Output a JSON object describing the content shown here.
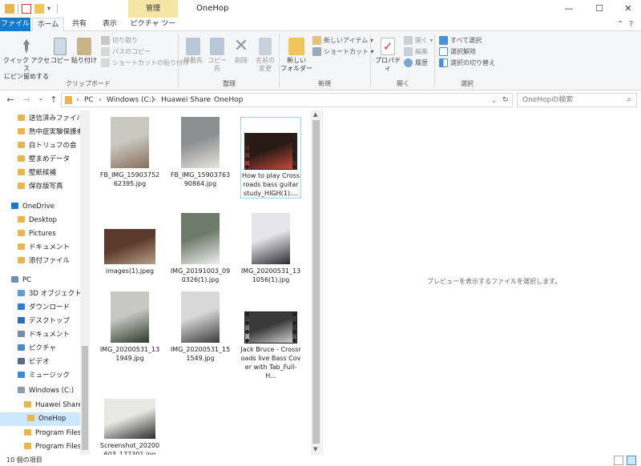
{
  "window": {
    "title": "OneHop",
    "context_tab_header": "管理",
    "controls": {
      "minimize": "—",
      "maximize": "☐",
      "close": "✕"
    }
  },
  "tabs": {
    "file": "ファイル",
    "home": "ホーム",
    "share": "共有",
    "view": "表示",
    "picture_tools": "ピクチャ ツール"
  },
  "ribbon": {
    "clipboard": {
      "pin_line1": "クイック アクセス",
      "pin_line2": "にピン留めする",
      "copy": "コピー",
      "paste": "貼り付け",
      "cut": "切り取り",
      "copy_path": "パスのコピー",
      "paste_shortcut": "ショートカットの貼り付け",
      "label": "クリップボード"
    },
    "organize": {
      "move_to": "移動先",
      "copy_to": "コピー先",
      "delete": "削除",
      "rename_line1": "名前の",
      "rename_line2": "変更",
      "label": "整理"
    },
    "new": {
      "new_folder_line1": "新しい",
      "new_folder_line2": "フォルダー",
      "new_item": "新しいアイテム",
      "shortcut": "ショートカット",
      "label": "新規"
    },
    "open": {
      "properties": "プロパティ",
      "open": "開く",
      "edit": "編集",
      "history": "履歴",
      "label": "開く"
    },
    "select": {
      "select_all": "すべて選択",
      "select_none": "選択解除",
      "invert": "選択の切り替え",
      "label": "選択"
    }
  },
  "address": {
    "crumbs": [
      "PC",
      "Windows (C:)",
      "Huawei Share",
      "OneHop"
    ],
    "search_placeholder": "OneHopの検索"
  },
  "nav": [
    {
      "label": "送信済みファイル",
      "type": "folder"
    },
    {
      "label": "熱中症実験保護者",
      "type": "folder"
    },
    {
      "label": "白トリュフの会",
      "type": "folder"
    },
    {
      "label": "壁まめデータ",
      "type": "folder"
    },
    {
      "label": "壁紙候補",
      "type": "folder"
    },
    {
      "label": "保存版写真",
      "type": "folder"
    },
    {
      "label": "OneDrive",
      "type": "cloud"
    },
    {
      "label": "Desktop",
      "type": "folder"
    },
    {
      "label": "Pictures",
      "type": "folder"
    },
    {
      "label": "ドキュメント",
      "type": "folder"
    },
    {
      "label": "添付ファイル",
      "type": "folder"
    },
    {
      "label": "PC",
      "type": "pc"
    },
    {
      "label": "3D オブジェクト",
      "type": "3d"
    },
    {
      "label": "ダウンロード",
      "type": "download"
    },
    {
      "label": "デスクトップ",
      "type": "desktop"
    },
    {
      "label": "ドキュメント",
      "type": "doc"
    },
    {
      "label": "ピクチャ",
      "type": "pic"
    },
    {
      "label": "ビデオ",
      "type": "video"
    },
    {
      "label": "ミュージック",
      "type": "music"
    },
    {
      "label": "Windows (C:)",
      "type": "drive"
    },
    {
      "label": "Huawei Share",
      "type": "folder"
    },
    {
      "label": "OneHop",
      "type": "folder"
    },
    {
      "label": "Program Files",
      "type": "folder"
    },
    {
      "label": "Program Files (",
      "type": "folder"
    }
  ],
  "files": [
    {
      "name": "FB_IMG_1590375262395.jpg",
      "kind": "photo",
      "tone": "dog"
    },
    {
      "name": "FB_IMG_1590376390864.jpg",
      "kind": "photo",
      "tone": "dog2"
    },
    {
      "name": "How to play Crossroads bass guitar study_HIGH(1)....",
      "kind": "video",
      "tone": "guitar"
    },
    {
      "name": "images(1).jpeg",
      "kind": "photo",
      "tone": "desk"
    },
    {
      "name": "IMG_20191003_090326(1).jpg",
      "kind": "photo",
      "tone": "dog3"
    },
    {
      "name": "IMG_20200531_131056(1).jpg",
      "kind": "photo",
      "tone": "laptop"
    },
    {
      "name": "IMG_20200531_131949.jpg",
      "kind": "photo",
      "tone": "laptop2"
    },
    {
      "name": "IMG_20200531_151549.jpg",
      "kind": "photo",
      "tone": "laptop3"
    },
    {
      "name": "Jack Bruce - Crossroads live Bass Cover with Tab_Full-H...",
      "kind": "video",
      "tone": "bass"
    },
    {
      "name": "Screenshot_20200603_172301.jpg",
      "kind": "photo",
      "tone": "screen"
    }
  ],
  "preview": {
    "message": "プレビューを表示するファイルを選択します。"
  },
  "status": {
    "count": "10 個の項目"
  },
  "colors": {
    "accent": "#1979ca",
    "selection": "#cce8ff",
    "context_tab": "#f6e6a6"
  }
}
